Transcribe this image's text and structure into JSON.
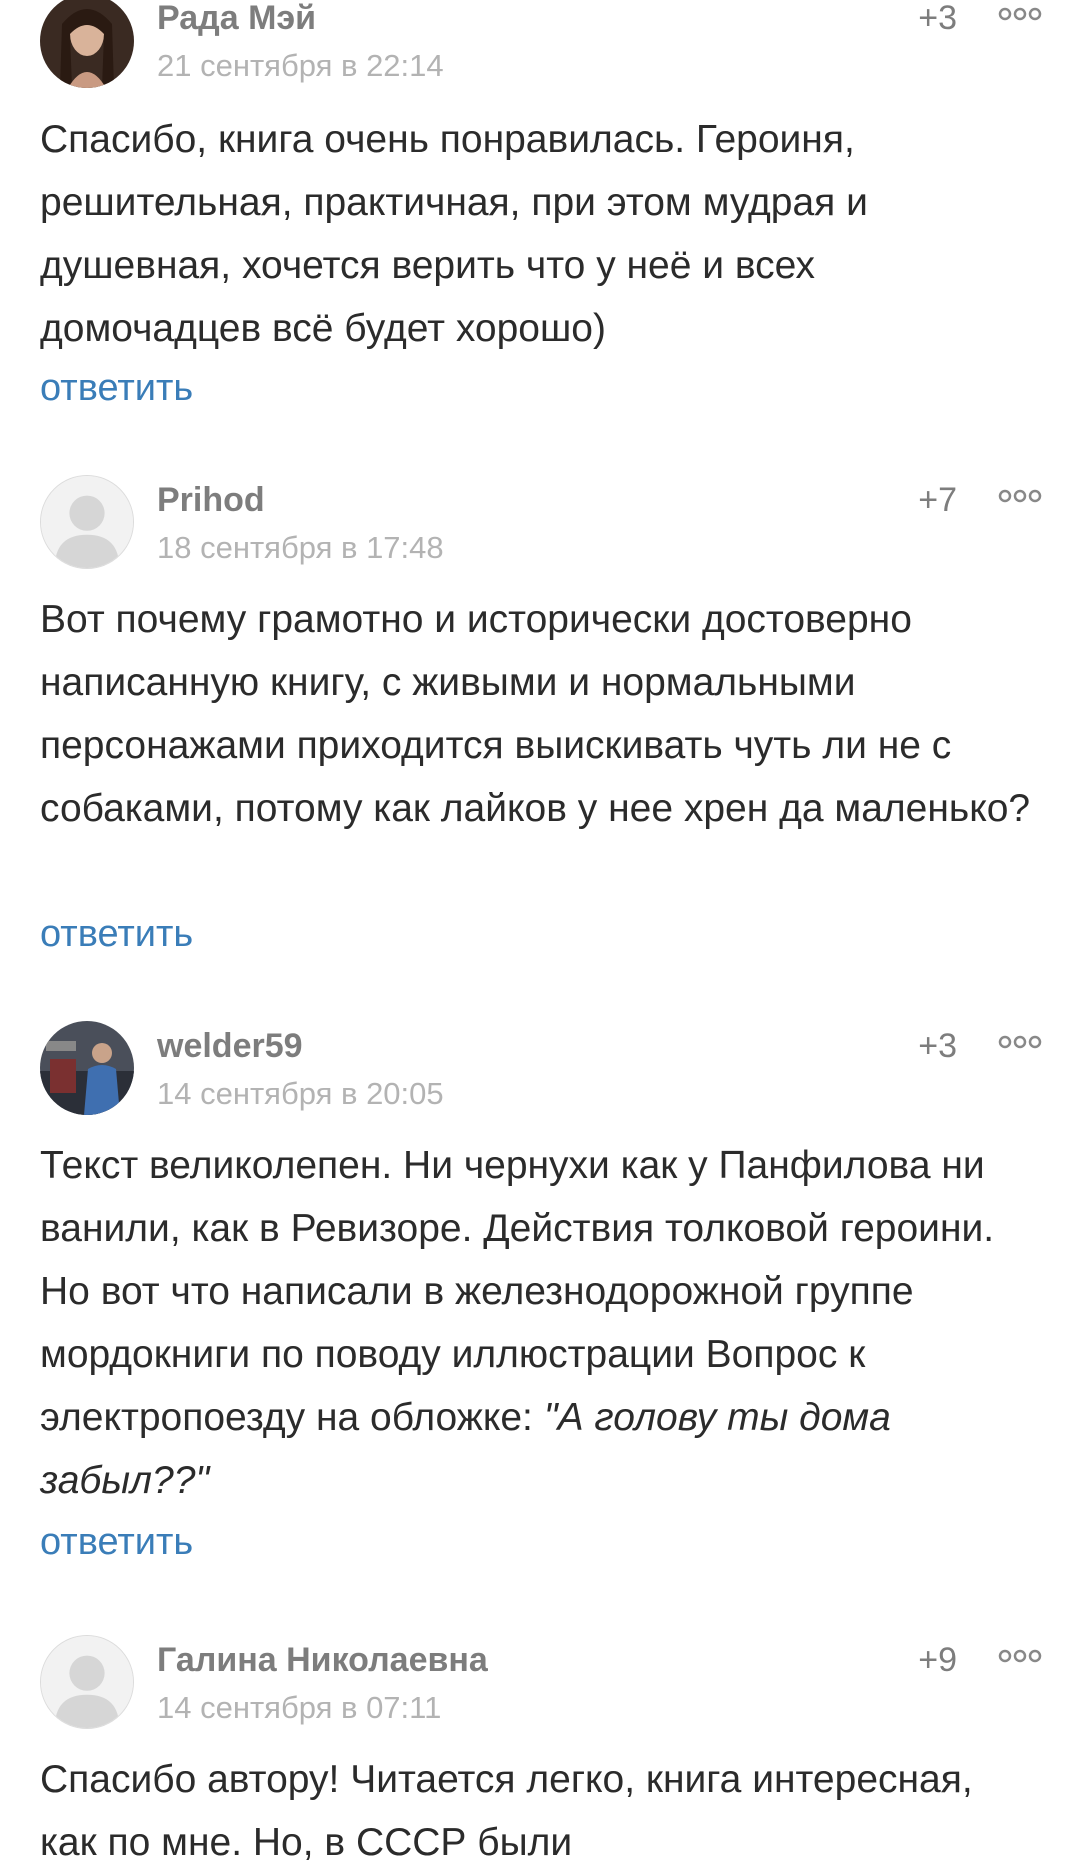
{
  "comments": [
    {
      "author": "Рада Мэй",
      "date": "21 сентября в 22:14",
      "rating": "+3",
      "text": "Спасибо, книга очень понравилась. Героиня, решительная, практичная, при этом мудрая и душевная, хочется верить что у неё и всех домочадцев всё будет хорошо)",
      "reply_label": "ответить"
    },
    {
      "author": "Prihod",
      "date": "18 сентября в 17:48",
      "rating": "+7",
      "text": "Вот почему грамотно и исторически достоверно написанную книгу, с живыми и нормальными персонажами приходится выискивать чуть ли не с собаками, потому как лайков у нее хрен да маленько?",
      "reply_label": "ответить"
    },
    {
      "author": "welder59",
      "date": "14 сентября в 20:05",
      "rating": "+3",
      "text": "Текст великолепен. Ни чернухи как у Панфилова ни ванили, как в Ревизоре. Действия толковой героини. Но вот что написали в железнодорожной группе мордокниги по поводу иллюстрации Вопрос к электропоезду на обложке: ",
      "text_quote": "\"А голову ты дома забыл??\"",
      "reply_label": "ответить"
    },
    {
      "author": "Галина Николаевна",
      "date": "14 сентября в 07:11",
      "rating": "+9",
      "text": "Спасибо автору! Читается легко, книга интересная, как по мне. Но, в СССР были"
    }
  ],
  "icons": {
    "more": "more-options-icon",
    "avatar_placeholder": "user-silhouette-icon"
  },
  "colors": {
    "link": "#3a7db8",
    "author": "#7d7d7d",
    "date": "#b3b3b3",
    "text": "#2b2b2b"
  }
}
